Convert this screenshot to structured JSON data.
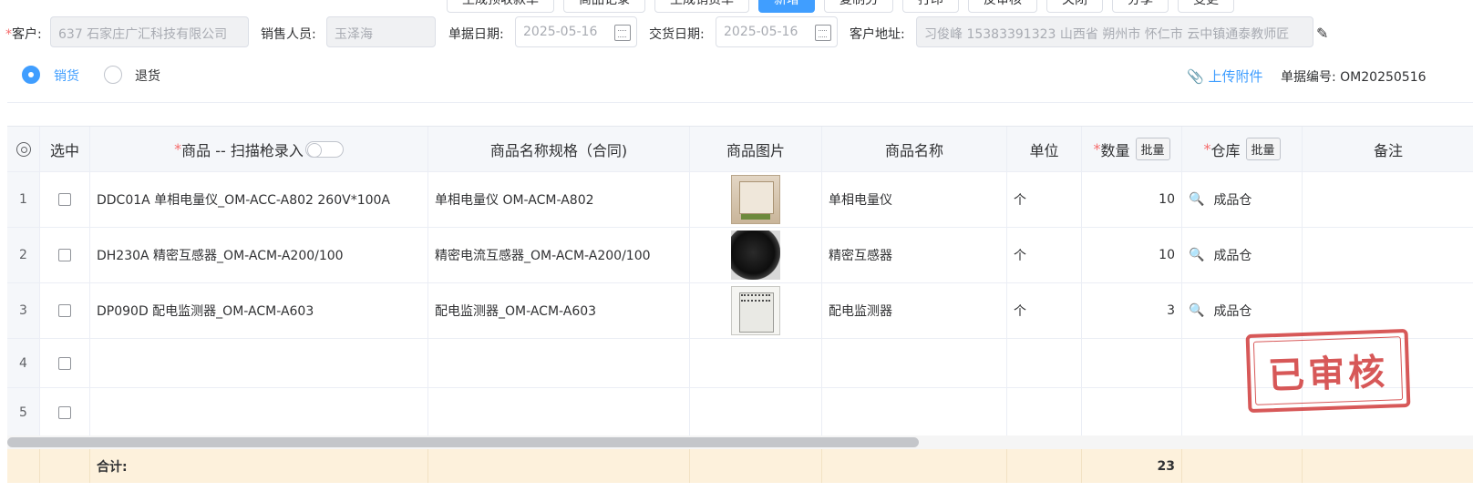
{
  "toolbar": {
    "buttons": [
      "生成预收款单",
      "商品记录",
      "生成销货单",
      "新增",
      "复制另",
      "打印",
      "反审核",
      "关闭",
      "分享",
      "变更"
    ]
  },
  "form": {
    "customer_label": "客户:",
    "customer_value": "637 石家庄广汇科技有限公司",
    "salesperson_label": "销售人员:",
    "salesperson_value": "玉泽海",
    "doc_date_label": "单据日期:",
    "doc_date_value": "2025-05-16",
    "delivery_date_label": "交货日期:",
    "delivery_date_value": "2025-05-16",
    "address_label": "客户地址:",
    "address_value": "习俊峰 15383391323 山西省 朔州市 怀仁市 云中镇通泰教师匠"
  },
  "type": {
    "sale_label": "销货",
    "return_label": "退货"
  },
  "upload_label": "上传附件",
  "order_no_label": "单据编号: OM20250516",
  "table": {
    "headers": {
      "select": "选中",
      "product": "商品 -- 扫描枪录入",
      "spec": "商品名称规格（合同)",
      "image": "商品图片",
      "name": "商品名称",
      "unit": "单位",
      "qty": "数量",
      "warehouse": "仓库",
      "remark": "备注",
      "batch": "批量"
    },
    "rows": [
      {
        "idx": "1",
        "product": "DDC01A 单相电量仪_OM-ACC-A802 260V*100A",
        "spec": "单相电量仪 OM-ACM-A802",
        "name": "单相电量仪",
        "unit": "个",
        "qty": "10",
        "warehouse": "成品仓"
      },
      {
        "idx": "2",
        "product": "DH230A 精密互感器_OM-ACM-A200/100",
        "spec": "精密电流互感器_OM-ACM-A200/100",
        "name": "精密互感器",
        "unit": "个",
        "qty": "10",
        "warehouse": "成品仓"
      },
      {
        "idx": "3",
        "product": "DP090D 配电监测器_OM-ACM-A603",
        "spec": "配电监测器_OM-ACM-A603",
        "name": "配电监测器",
        "unit": "个",
        "qty": "3",
        "warehouse": "成品仓"
      },
      {
        "idx": "4"
      },
      {
        "idx": "5"
      }
    ],
    "footer": {
      "label": "合计:",
      "qty_total": "23"
    }
  },
  "stamp_text": "已审核",
  "icons": {
    "calendar": "calendar-icon",
    "edit": "edit-icon",
    "paperclip": "paperclip-icon",
    "search": "search-icon",
    "settings": "gear-icon"
  },
  "colors": {
    "primary": "#409eff",
    "required": "#f56c6c",
    "stamp": "#d13b3b",
    "footer_bg": "#fdf1dc"
  }
}
